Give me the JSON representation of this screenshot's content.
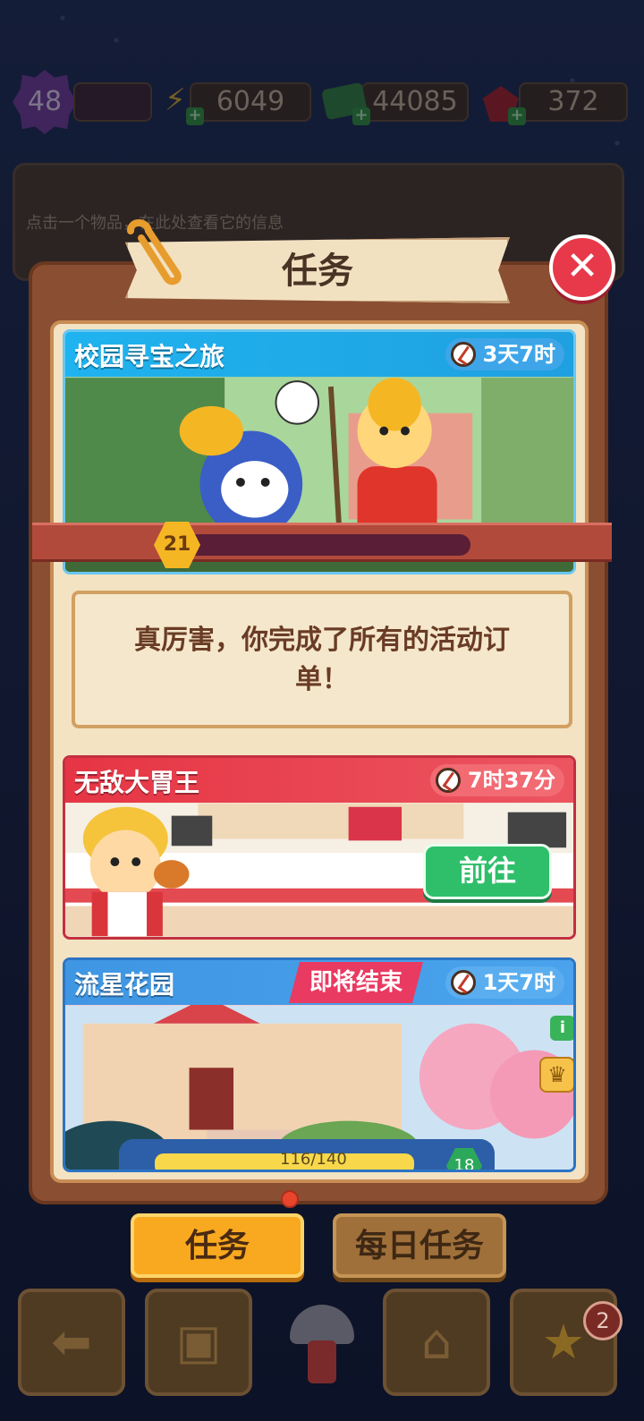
{
  "resources": {
    "level": "48",
    "energy": "6049",
    "cash": "44085",
    "gems": "372"
  },
  "info_panel": {
    "hint": "点击一个物品，在此处查看它的信息"
  },
  "dialog": {
    "title": "任务",
    "close_icon": "close-icon"
  },
  "events": [
    {
      "title": "校园寻宝之旅",
      "timer": "3天7时",
      "level": "21",
      "progress": 0.0,
      "message": "真厉害，你完成了所有的活动订单！",
      "header_color": "#1fb3ef"
    },
    {
      "title": "无敌大胃王",
      "timer": "7时37分",
      "button": "前往",
      "header_color": "#ea3c4c"
    },
    {
      "title": "流星花园",
      "tag": "即将结束",
      "timer": "1天7时",
      "header_color": "#3f96e3",
      "progress_text": "116/140",
      "level": "18"
    }
  ],
  "tabs": {
    "quests": "任务",
    "daily": "每日任务"
  },
  "nav": {
    "back_icon": "back-arrow-icon",
    "bag_icon": "backpack-icon",
    "shop_icon": "basket-icon",
    "star_icon": "star-icon",
    "star_badge": "2"
  }
}
